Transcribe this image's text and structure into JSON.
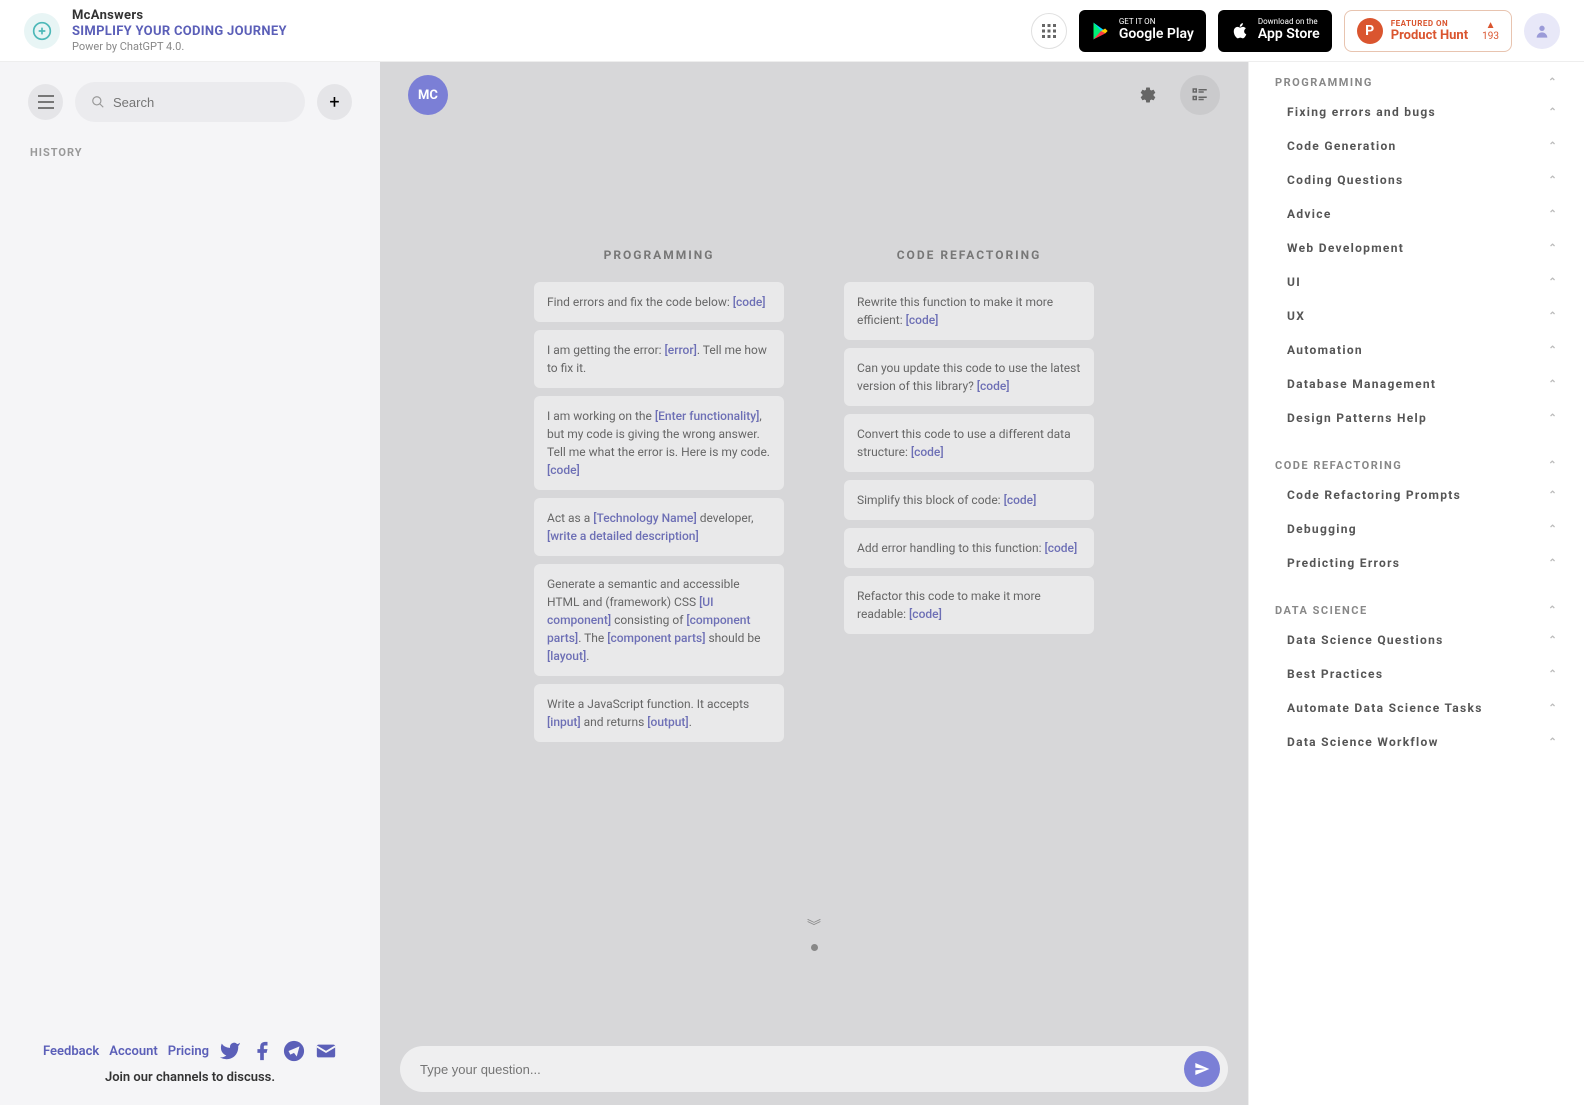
{
  "header": {
    "brand_name": "McAnswers",
    "tagline": "SIMPLIFY YOUR CODING JOURNEY",
    "power": "Power by ChatGPT 4.0.",
    "gp_top": "GET IT ON",
    "gp_bottom": "Google Play",
    "as_top": "Download on the",
    "as_bottom": "App Store",
    "ph_top": "FEATURED ON",
    "ph_bottom": "Product Hunt",
    "ph_letter": "P",
    "ph_count": "193"
  },
  "sidebar": {
    "search_placeholder": "Search",
    "history_label": "HISTORY",
    "footer": {
      "feedback": "Feedback",
      "account": "Account",
      "pricing": "Pricing",
      "join": "Join our channels to discuss."
    }
  },
  "chat": {
    "avatar_label": "MC",
    "input_placeholder": "Type your question...",
    "columns": [
      {
        "title": "PROGRAMMING",
        "prompts": [
          {
            "parts": [
              {
                "t": "Find errors and fix the code below: "
              },
              {
                "t": "[code]",
                "ph": true
              }
            ]
          },
          {
            "parts": [
              {
                "t": "I am getting the error: "
              },
              {
                "t": "[error]",
                "ph": true
              },
              {
                "t": ". Tell me how to fix it."
              }
            ]
          },
          {
            "parts": [
              {
                "t": "I am working on the "
              },
              {
                "t": "[Enter functionality]",
                "ph": true
              },
              {
                "t": ", but my code is giving the wrong answer. Tell me what the error is. Here is my code. "
              },
              {
                "t": "[code]",
                "ph": true
              }
            ]
          },
          {
            "parts": [
              {
                "t": "Act as a "
              },
              {
                "t": "[Technology Name]",
                "ph": true
              },
              {
                "t": " developer, "
              },
              {
                "t": "[write a detailed description]",
                "ph": true
              }
            ]
          },
          {
            "parts": [
              {
                "t": "Generate a semantic and accessible HTML and (framework) CSS "
              },
              {
                "t": "[UI component]",
                "ph": true
              },
              {
                "t": " consisting of "
              },
              {
                "t": "[component parts]",
                "ph": true
              },
              {
                "t": ". The "
              },
              {
                "t": "[component parts]",
                "ph": true
              },
              {
                "t": " should be "
              },
              {
                "t": "[layout]",
                "ph": true
              },
              {
                "t": "."
              }
            ]
          },
          {
            "parts": [
              {
                "t": "Write a JavaScript function. It accepts "
              },
              {
                "t": "[input]",
                "ph": true
              },
              {
                "t": " and returns "
              },
              {
                "t": "[output]",
                "ph": true
              },
              {
                "t": "."
              }
            ]
          }
        ]
      },
      {
        "title": "CODE REFACTORING",
        "prompts": [
          {
            "parts": [
              {
                "t": "Rewrite this function to make it more efficient: "
              },
              {
                "t": "[code]",
                "ph": true
              }
            ]
          },
          {
            "parts": [
              {
                "t": "Can you update this code to use the latest version of this library? "
              },
              {
                "t": "[code]",
                "ph": true
              }
            ]
          },
          {
            "parts": [
              {
                "t": "Convert this code to use a different data structure: "
              },
              {
                "t": "[code]",
                "ph": true
              }
            ]
          },
          {
            "parts": [
              {
                "t": "Simplify this block of code: "
              },
              {
                "t": "[code]",
                "ph": true
              }
            ]
          },
          {
            "parts": [
              {
                "t": "Add error handling to this function: "
              },
              {
                "t": "[code]",
                "ph": true
              }
            ]
          },
          {
            "parts": [
              {
                "t": "Refactor this code to make it more readable: "
              },
              {
                "t": "[code]",
                "ph": true
              }
            ]
          }
        ]
      }
    ]
  },
  "panel": {
    "sections": [
      {
        "title": "PROGRAMMING",
        "items": [
          "Fixing errors and bugs",
          "Code Generation",
          "Coding Questions",
          "Advice",
          "Web Development",
          "UI",
          "UX",
          "Automation",
          "Database Management",
          "Design Patterns Help"
        ]
      },
      {
        "title": "CODE REFACTORING",
        "items": [
          "Code Refactoring Prompts",
          "Debugging",
          "Predicting Errors"
        ]
      },
      {
        "title": "DATA SCIENCE",
        "items": [
          "Data Science Questions",
          "Best Practices",
          "Automate Data Science Tasks",
          "Data Science Workflow"
        ]
      }
    ]
  }
}
